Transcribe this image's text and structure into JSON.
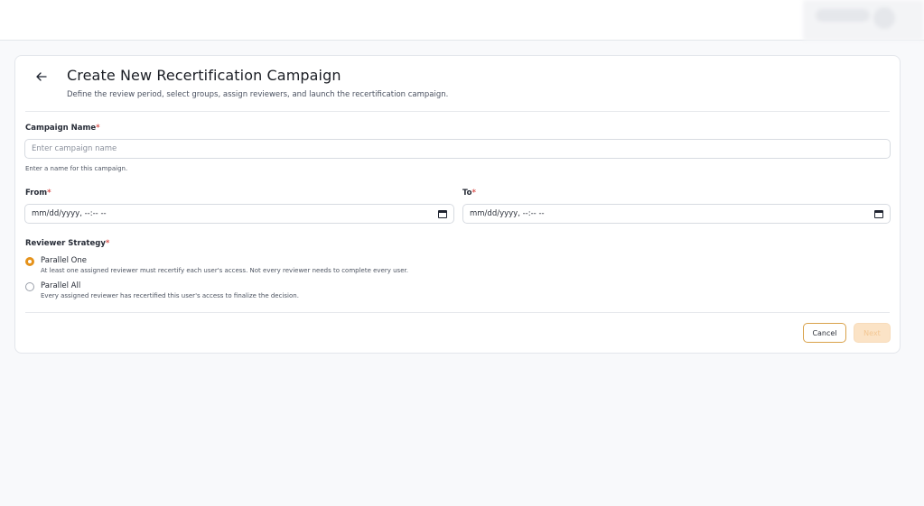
{
  "header": {
    "title": "Create New Recertification Campaign",
    "subtitle": "Define the review period, select groups, assign reviewers, and launch the recertification campaign."
  },
  "form": {
    "campaign_name": {
      "label": "Campaign Name",
      "required_mark": "*",
      "value": "",
      "placeholder": "Enter campaign name",
      "help": "Enter a name for this campaign."
    },
    "from": {
      "label": "From",
      "required_mark": "*",
      "display": "mm/dd/yyyy, --:-- --"
    },
    "to": {
      "label": "To",
      "required_mark": "*",
      "display": "mm/dd/yyyy, --:-- --"
    },
    "reviewer_strategy": {
      "label": "Reviewer Strategy",
      "required_mark": "*",
      "selected": "Parallel One",
      "options": [
        {
          "title": "Parallel One",
          "description": "At least one assigned reviewer must recertify each user's access. Not every reviewer needs to complete every user."
        },
        {
          "title": "Parallel All",
          "description": "Every assigned reviewer has recertified this user's access to finalize the decision."
        }
      ]
    }
  },
  "actions": {
    "cancel_label": "Cancel",
    "next_label": "Next"
  },
  "colors": {
    "accent": "#e5921a",
    "required": "#d9534f",
    "next_disabled_bg": "#fbe3c6"
  }
}
